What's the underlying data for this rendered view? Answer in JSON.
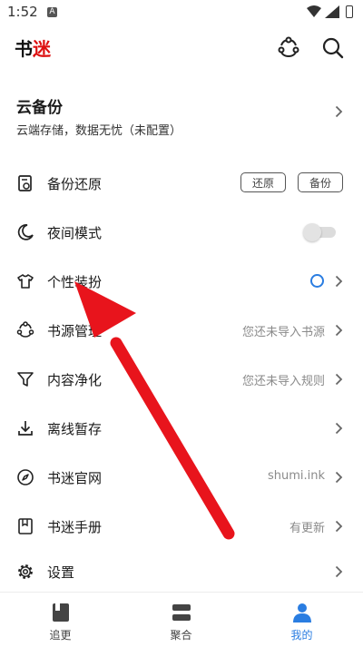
{
  "status_bar": {
    "time": "1:52",
    "notification_icon": "A"
  },
  "app_bar": {
    "logo_black": "书",
    "logo_red": "迷",
    "icons": [
      "sync-icon",
      "search-icon"
    ]
  },
  "backup_card": {
    "title": "云备份",
    "subtitle": "云端存储，数据无忧（未配置）"
  },
  "menu": {
    "backup_restore": {
      "label": "备份还原",
      "restore_button": "还原",
      "backup_button": "备份"
    },
    "night_mode": {
      "label": "夜间模式",
      "enabled": false
    },
    "theme": {
      "label": "个性装扮",
      "accent_color": "#2a7de1"
    },
    "book_source": {
      "label": "书源管理",
      "value": "您还未导入书源"
    },
    "content_purify": {
      "label": "内容净化",
      "value": "您还未导入规则"
    },
    "offline_cache": {
      "label": "离线暂存"
    },
    "official_site": {
      "label": "书迷官网",
      "value": "shumi.ink"
    },
    "manual": {
      "label": "书迷手册",
      "value": "有更新"
    },
    "settings": {
      "label": "设置"
    }
  },
  "bottom_nav": {
    "tabs": [
      {
        "label": "追更",
        "icon": "book-icon",
        "active": false
      },
      {
        "label": "聚合",
        "icon": "stack-icon",
        "active": false
      },
      {
        "label": "我的",
        "icon": "person-icon",
        "active": true
      }
    ]
  },
  "colors": {
    "accent": "#2a7de1",
    "annotation_arrow": "#e8141c"
  }
}
